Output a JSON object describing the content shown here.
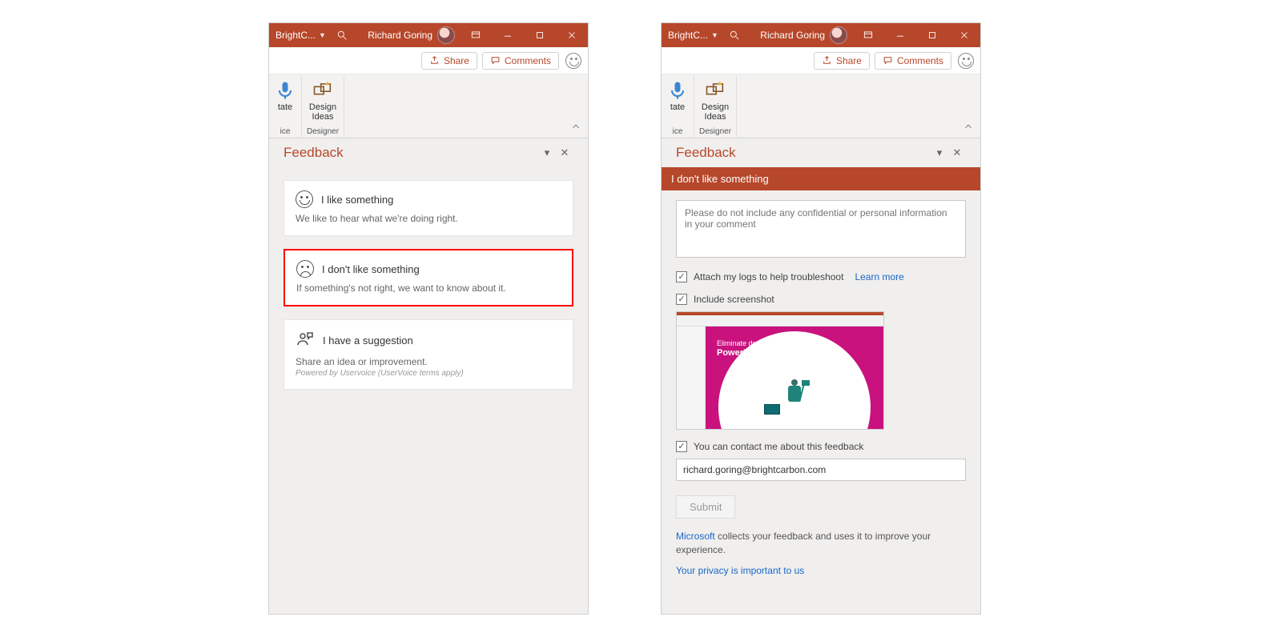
{
  "titlebar": {
    "doc": "BrightC...",
    "user": "Richard Goring"
  },
  "actionbar": {
    "share": "Share",
    "comments": "Comments"
  },
  "ribbon": {
    "group1": {
      "text": "tate",
      "label": "ice"
    },
    "group2": {
      "text": "Design\nIdeas",
      "label": "Designer"
    }
  },
  "pane": {
    "title": "Feedback"
  },
  "cards": {
    "like": {
      "title": "I like something",
      "desc": "We like to hear what we're doing right."
    },
    "dislike": {
      "title": "I don't like something",
      "desc": "If something's not right, we want to know about it."
    },
    "suggest": {
      "title": "I have a suggestion",
      "desc": "Share an idea or improvement.",
      "fine": "Powered by Uservoice (UserVoice terms apply)"
    }
  },
  "form": {
    "header": "I don't like something",
    "placeholder": "Please do not include any confidential or personal information in your comment",
    "attach": "Attach my logs to help troubleshoot",
    "learnmore": "Learn more",
    "include": "Include screenshot",
    "screenshot_line1": "Eliminate death by",
    "screenshot_line2": "PowerPoint",
    "contact": "You can contact me about this feedback",
    "email": "richard.goring@brightcarbon.com",
    "submit": "Submit",
    "foot_link": "Microsoft",
    "foot_rest": " collects your feedback and uses it to improve your experience.",
    "privacy": "Your privacy is important to us"
  }
}
